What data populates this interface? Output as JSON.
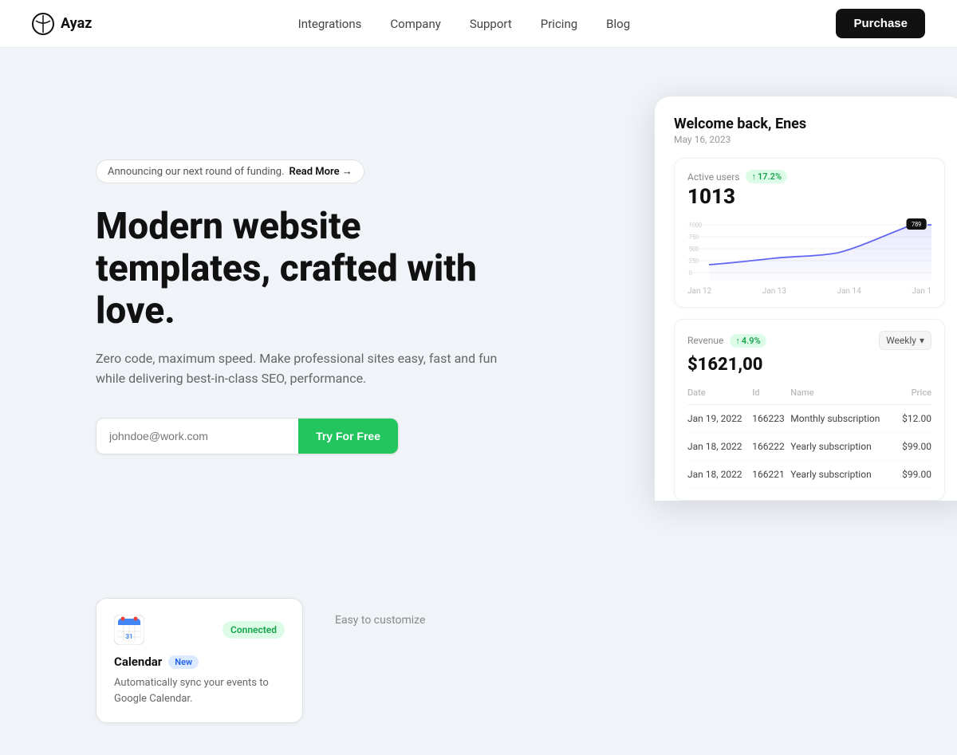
{
  "navbar": {
    "logo_text": "Ayaz",
    "links": [
      {
        "label": "Integrations",
        "id": "integrations"
      },
      {
        "label": "Company",
        "id": "company"
      },
      {
        "label": "Support",
        "id": "support"
      },
      {
        "label": "Pricing",
        "id": "pricing"
      },
      {
        "label": "Blog",
        "id": "blog"
      }
    ],
    "purchase_label": "Purchase"
  },
  "hero": {
    "announcement": "Announcing our next round of funding.",
    "read_more": "Read More →",
    "title": "Modern website templates, crafted with love.",
    "subtitle": "Zero code, maximum speed. Make professional sites easy, fast and fun while delivering best-in-class SEO, performance.",
    "input_placeholder": "johndoe@work.com",
    "cta_label": "Try For Free"
  },
  "dashboard": {
    "welcome": "Welcome back, Enes",
    "date": "May 16, 2023",
    "active_users": {
      "label": "Active users",
      "badge": "17.2%",
      "value": "1013",
      "chart_y_labels": [
        "1000",
        "750",
        "500",
        "250",
        "0"
      ],
      "chart_x_labels": [
        "Jan 12",
        "Jan 13",
        "Jan 14",
        "Jan 1"
      ],
      "tooltip_value": "789"
    },
    "revenue": {
      "label": "Revenue",
      "badge": "4.9%",
      "dropdown": "Weekly",
      "value": "$1621,00",
      "table": {
        "headers": [
          "Date",
          "Id",
          "Name",
          "Price"
        ],
        "rows": [
          {
            "date": "Jan 19, 2022",
            "id": "166223",
            "name": "Monthly subscription",
            "price": "$12.00"
          },
          {
            "date": "Jan 18, 2022",
            "id": "166222",
            "name": "Yearly subscription",
            "price": "$99.00"
          },
          {
            "date": "Jan 18, 2022",
            "id": "166221",
            "name": "Yearly subscription",
            "price": "$99.00"
          }
        ]
      }
    }
  },
  "integration_card": {
    "title": "Calendar",
    "new_label": "New",
    "connected_label": "Connected",
    "description": "Automatically sync your events to Google Calendar."
  },
  "customize_text": "Easy to customize"
}
